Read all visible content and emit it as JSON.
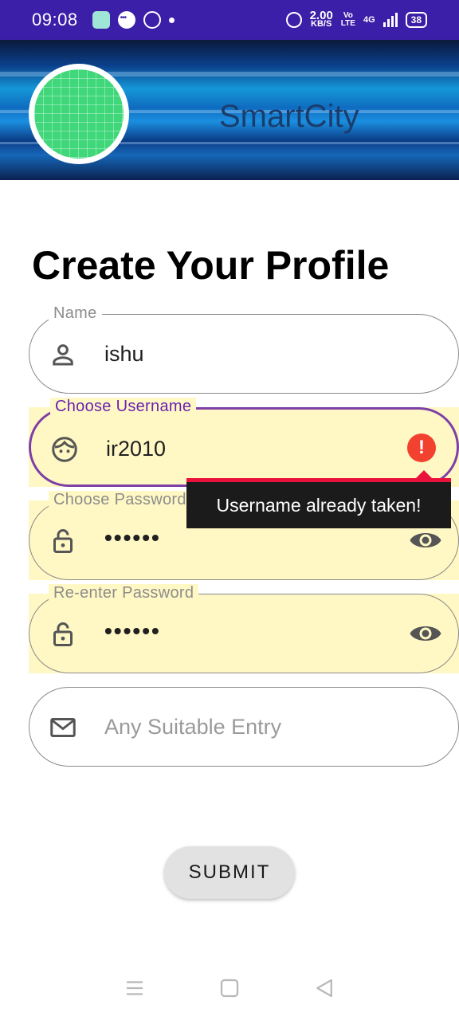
{
  "status_bar": {
    "time": "09:08",
    "net_speed_value": "2.00",
    "net_speed_unit": "KB/S",
    "volte_top": "Vo",
    "volte_bottom": "LTE",
    "network": "4G",
    "battery": "38"
  },
  "header": {
    "app_title": "SmartCity",
    "logo": "green-grid-circle-logo"
  },
  "page_title": "Create Your Profile",
  "form": {
    "name": {
      "label": "Name",
      "value": "ishu",
      "icon": "person-icon"
    },
    "username": {
      "label": "Choose Username",
      "value": "ir2010",
      "icon": "face-icon",
      "error_icon": "!",
      "error": "Username already taken!"
    },
    "password": {
      "label": "Choose Password",
      "value": "••••••",
      "icon": "lock-icon",
      "toggle_icon": "eye-icon"
    },
    "reenter_password": {
      "label": "Re-enter Password",
      "value": "••••••",
      "icon": "lock-icon",
      "toggle_icon": "eye-icon"
    },
    "email": {
      "placeholder": "Any Suitable Entry",
      "icon": "mail-icon"
    }
  },
  "submit_label": "SUBMIT",
  "colors": {
    "status_bar": "#3b1fa8",
    "focus_border": "#7e3fa6",
    "label_focused": "#6b22b0",
    "highlight_fill": "#fff8c4",
    "error": "#f2412e",
    "tooltip_bg": "#1b1b1b",
    "tooltip_border": "#e8123c"
  },
  "nav_bar": [
    "menu-icon",
    "home-square-icon",
    "back-triangle-icon"
  ]
}
